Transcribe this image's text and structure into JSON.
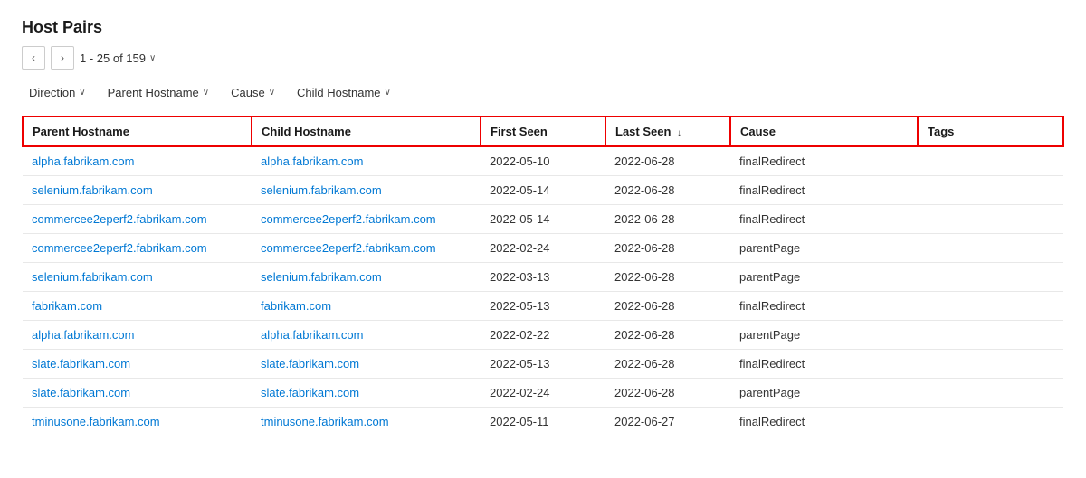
{
  "title": "Host Pairs",
  "pagination": {
    "current": "1 - 25 of 159",
    "chevron": "∨"
  },
  "filters": [
    {
      "id": "direction",
      "label": "Direction"
    },
    {
      "id": "parent-hostname",
      "label": "Parent Hostname"
    },
    {
      "id": "cause",
      "label": "Cause"
    },
    {
      "id": "child-hostname",
      "label": "Child Hostname"
    }
  ],
  "columns": [
    {
      "id": "parent-hostname",
      "label": "Parent Hostname",
      "sortable": false
    },
    {
      "id": "child-hostname",
      "label": "Child Hostname",
      "sortable": false
    },
    {
      "id": "first-seen",
      "label": "First Seen",
      "sortable": false
    },
    {
      "id": "last-seen",
      "label": "Last Seen",
      "sortable": true,
      "sort_dir": "↓"
    },
    {
      "id": "cause",
      "label": "Cause",
      "sortable": false
    },
    {
      "id": "tags",
      "label": "Tags",
      "sortable": false
    }
  ],
  "rows": [
    {
      "parent": "alpha.fabrikam.com",
      "child": "alpha.fabrikam.com",
      "first_seen": "2022-05-10",
      "last_seen": "2022-06-28",
      "cause": "finalRedirect",
      "tags": ""
    },
    {
      "parent": "selenium.fabrikam.com",
      "child": "selenium.fabrikam.com",
      "first_seen": "2022-05-14",
      "last_seen": "2022-06-28",
      "cause": "finalRedirect",
      "tags": ""
    },
    {
      "parent": "commercee2eperf2.fabrikam.com",
      "child": "commercee2eperf2.fabrikam.com",
      "first_seen": "2022-05-14",
      "last_seen": "2022-06-28",
      "cause": "finalRedirect",
      "tags": ""
    },
    {
      "parent": "commercee2eperf2.fabrikam.com",
      "child": "commercee2eperf2.fabrikam.com",
      "first_seen": "2022-02-24",
      "last_seen": "2022-06-28",
      "cause": "parentPage",
      "tags": ""
    },
    {
      "parent": "selenium.fabrikam.com",
      "child": "selenium.fabrikam.com",
      "first_seen": "2022-03-13",
      "last_seen": "2022-06-28",
      "cause": "parentPage",
      "tags": ""
    },
    {
      "parent": "fabrikam.com",
      "child": "fabrikam.com",
      "first_seen": "2022-05-13",
      "last_seen": "2022-06-28",
      "cause": "finalRedirect",
      "tags": ""
    },
    {
      "parent": "alpha.fabrikam.com",
      "child": "alpha.fabrikam.com",
      "first_seen": "2022-02-22",
      "last_seen": "2022-06-28",
      "cause": "parentPage",
      "tags": ""
    },
    {
      "parent": "slate.fabrikam.com",
      "child": "slate.fabrikam.com",
      "first_seen": "2022-05-13",
      "last_seen": "2022-06-28",
      "cause": "finalRedirect",
      "tags": ""
    },
    {
      "parent": "slate.fabrikam.com",
      "child": "slate.fabrikam.com",
      "first_seen": "2022-02-24",
      "last_seen": "2022-06-28",
      "cause": "parentPage",
      "tags": ""
    },
    {
      "parent": "tminusone.fabrikam.com",
      "child": "tminusone.fabrikam.com",
      "first_seen": "2022-05-11",
      "last_seen": "2022-06-27",
      "cause": "finalRedirect",
      "tags": ""
    }
  ]
}
